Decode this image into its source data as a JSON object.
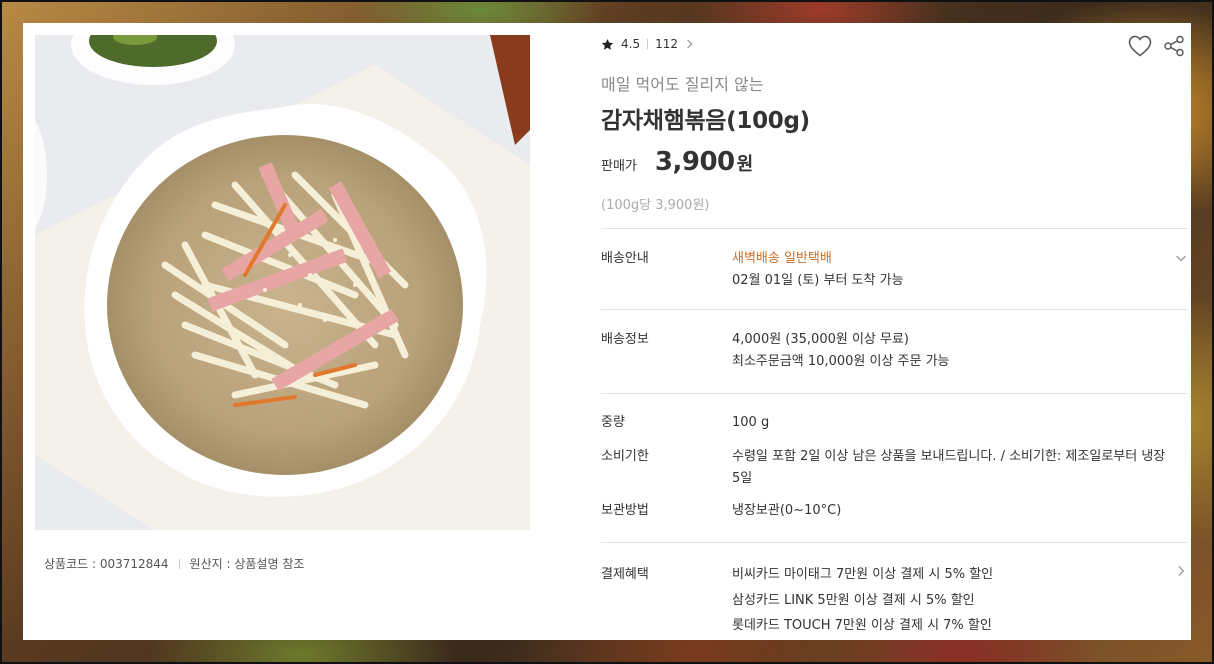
{
  "product": {
    "rating": "4.5",
    "review_count": "112",
    "subtitle": "매일 먹어도 질리지 않는",
    "title": "감자채햄볶음(100g)",
    "price_label": "판매가",
    "price": "3,900",
    "price_unit": "원",
    "unit_price": "(100g당 3,900원)",
    "product_code": "상품코드 : 003712844",
    "origin": "원산지 : 상품설명 참조"
  },
  "details": {
    "delivery_guide": {
      "label": "배송안내",
      "methods": "새벽배송 일반택배",
      "arrival": "02월 01일 (토) 부터 도착 가능"
    },
    "delivery_info": {
      "label": "배송정보",
      "fee": "4,000원 (35,000원 이상 무료)",
      "minimum": "최소주문금액 10,000원 이상 주문 가능"
    },
    "weight": {
      "label": "중량",
      "value": "100 g"
    },
    "expiry": {
      "label": "소비기한",
      "value": "수령일 포함 2일 이상 남은 상품을 보내드립니다. / 소비기한: 제조일로부터 냉장 5일"
    },
    "storage": {
      "label": "보관방법",
      "value": "냉장보관(0~10°C)"
    },
    "payment": {
      "label": "결제혜택",
      "benefits": [
        "비씨카드 마이태그 7만원 이상 결제 시 5% 할인",
        "삼성카드 LINK 5만원 이상 결제 시 5% 할인",
        "롯데카드 TOUCH 7만원 이상 결제 시 7% 할인"
      ]
    }
  },
  "icons": {
    "star": "star-icon",
    "heart": "heart-icon",
    "share": "share-icon",
    "chevron_down": "chevron-down-icon",
    "chevron_right": "chevron-right-icon"
  },
  "colors": {
    "accent": "#c76f2a",
    "text": "#333333",
    "muted": "#888888",
    "divider": "#e3e3e3"
  }
}
